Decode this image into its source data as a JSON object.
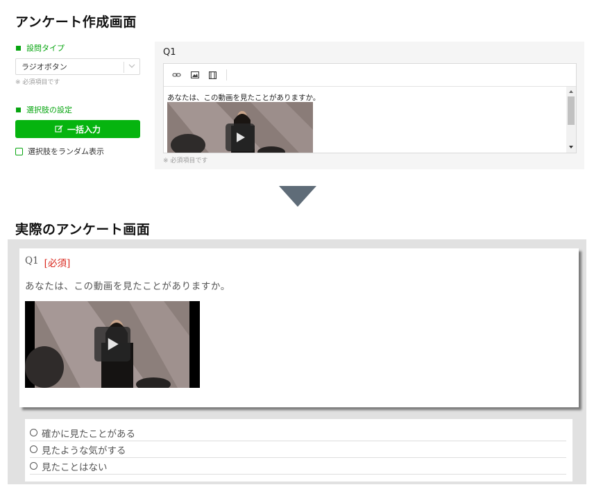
{
  "creation": {
    "title": "アンケート作成画面",
    "question_type_label": "設問タイプ",
    "question_type_value": "ラジオボタン",
    "required_note": "※ 必須項目です",
    "choices_label": "選択肢の設定",
    "bulk_input_label": "一括入力",
    "random_checkbox_label": "選択肢をランダム表示",
    "question_label": "Q1",
    "editor_text": "あなたは、この動画を見たことがありますか。",
    "editor_required_note": "※ 必須項目です"
  },
  "actual": {
    "title": "実際のアンケート画面",
    "question_number": "Q1",
    "required_tag": "[必須]",
    "question_text": "あなたは、この動画を見たことがありますか。",
    "options": [
      "確かに見たことがある",
      "見たような気がする",
      "見たことはない"
    ]
  },
  "colors": {
    "accent_green": "#06b40f",
    "required_red": "#d9261c",
    "arrow": "#5f6c78"
  },
  "icons": [
    "link-icon",
    "image-icon",
    "film-icon",
    "edit-icon",
    "play-icon",
    "chevron-down-icon"
  ]
}
